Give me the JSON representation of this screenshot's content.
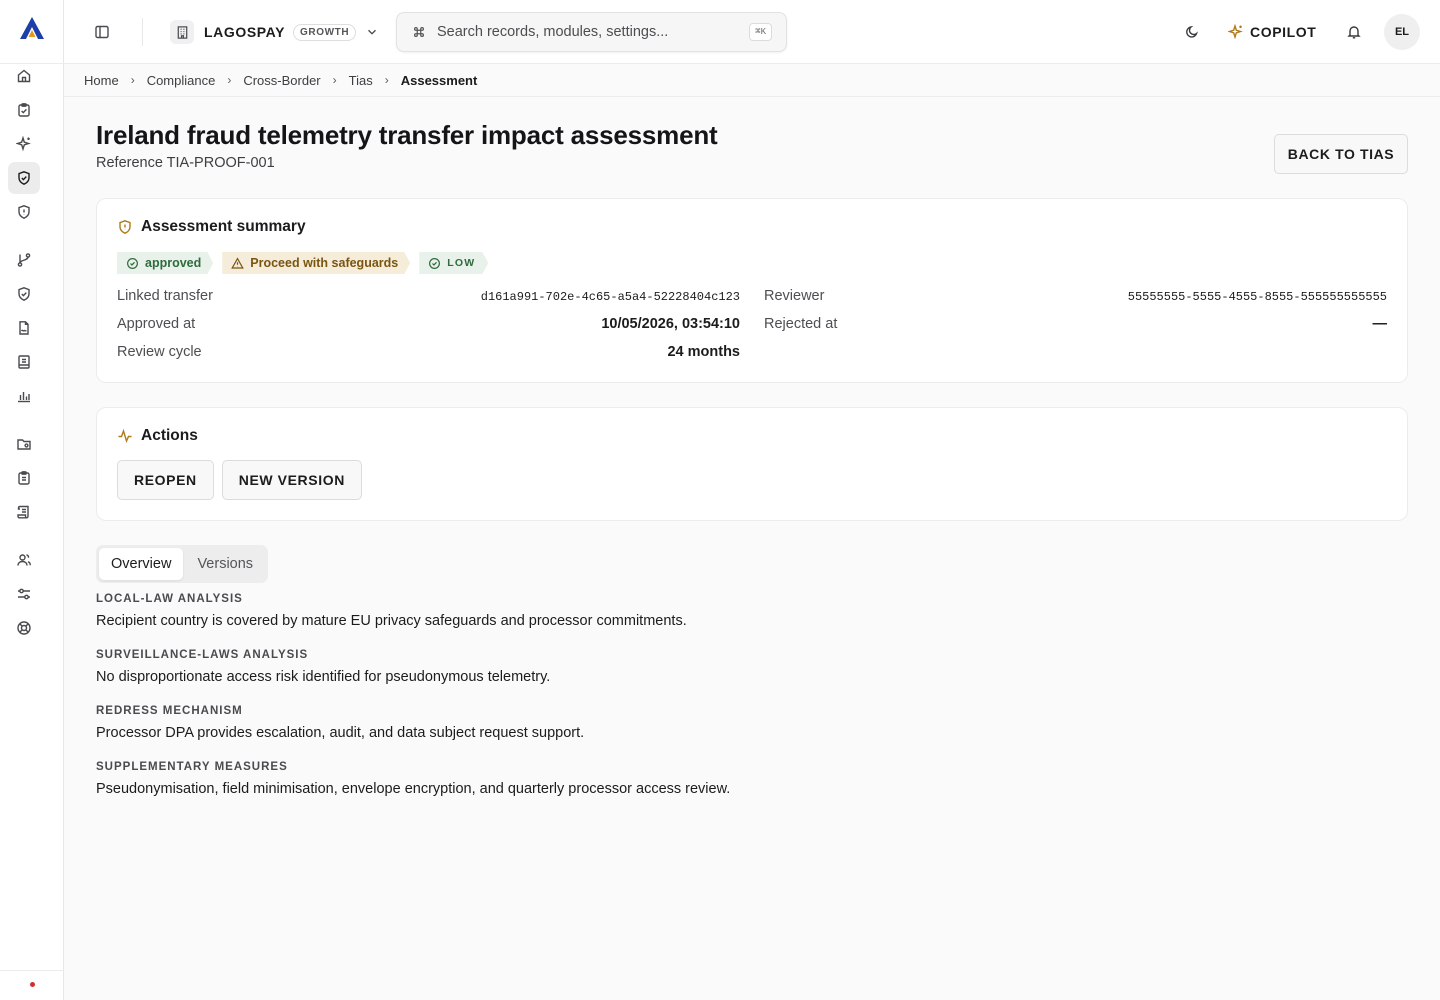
{
  "app": {
    "org_name": "LAGOSPAY",
    "plan": "GROWTH",
    "user_initials": "EL",
    "copilot_label": "COPILOT"
  },
  "search": {
    "placeholder": "Search records, modules, settings...",
    "shortcut": "⌘K"
  },
  "breadcrumb": [
    "Home",
    "Compliance",
    "Cross-Border",
    "Tias",
    "Assessment"
  ],
  "header": {
    "title": "Ireland fraud telemetry transfer impact assessment",
    "reference": "Reference TIA-PROOF-001",
    "back_label": "BACK TO TIAS"
  },
  "summary": {
    "title": "Assessment summary",
    "badges": {
      "status": "approved",
      "decision": "Proceed with safeguards",
      "risk": "LOW"
    },
    "left": [
      {
        "label": "Linked transfer",
        "value": "d161a991-702e-4c65-a5a4-52228404c123"
      },
      {
        "label": "Approved at",
        "value": "10/05/2026, 03:54:10"
      },
      {
        "label": "Review cycle",
        "value": "24 months"
      }
    ],
    "right": [
      {
        "label": "Reviewer",
        "value": "55555555-5555-4555-8555-555555555555"
      },
      {
        "label": "Rejected at",
        "value": "—"
      }
    ]
  },
  "actions": {
    "title": "Actions",
    "reopen_label": "REOPEN",
    "new_version_label": "NEW VERSION"
  },
  "tabs": [
    {
      "label": "Overview",
      "active": true
    },
    {
      "label": "Versions",
      "active": false
    }
  ],
  "sections": [
    {
      "label": "LOCAL-LAW ANALYSIS",
      "text": "Recipient country is covered by mature EU privacy safeguards and processor commitments."
    },
    {
      "label": "SURVEILLANCE-LAWS ANALYSIS",
      "text": "No disproportionate access risk identified for pseudonymous telemetry."
    },
    {
      "label": "REDRESS MECHANISM",
      "text": "Processor DPA provides escalation, audit, and data subject request support."
    },
    {
      "label": "SUPPLEMENTARY MEASURES",
      "text": "Pseudonymisation, field minimisation, envelope encryption, and quarterly processor access review."
    }
  ],
  "colors": {
    "accent": "#b07a18",
    "success": "#2f6b3c",
    "warning": "#7a5512",
    "danger": "#d0312d",
    "logo_blue": "#1f3fa8"
  },
  "icons": {
    "rail": [
      "home-icon",
      "clipboard-check-icon",
      "sparkles-icon",
      "shield-check-icon",
      "shield-icon",
      "git-branch-icon",
      "shield-check-icon",
      "file-signature-icon",
      "notebook-icon",
      "bar-chart-icon",
      "folder-icon",
      "clipboard-list-icon",
      "scroll-icon",
      "users-icon",
      "sliders-icon",
      "life-buoy-icon"
    ]
  }
}
